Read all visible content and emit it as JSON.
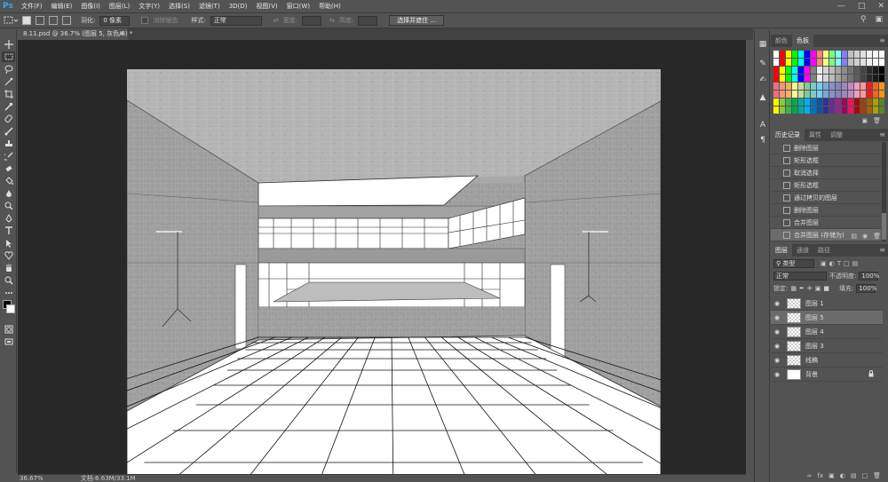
{
  "app": {
    "logo": "Ps"
  },
  "menu": [
    "文件(F)",
    "编辑(E)",
    "图像(I)",
    "图层(L)",
    "文字(Y)",
    "选择(S)",
    "滤镜(T)",
    "3D(D)",
    "视图(V)",
    "窗口(W)",
    "帮助(H)"
  ],
  "options": {
    "feather_label": "羽化:",
    "feather_value": "0 像素",
    "antialias_label": "消除锯齿",
    "style_label": "样式:",
    "style_value": "正常",
    "width_label": "宽度:",
    "height_label": "高度:",
    "select_mask_button": "选择并遮住 ..."
  },
  "document": {
    "tab_title": "8.11.psd @ 36.7% (图层 5, 灰色/8) *",
    "close": "×"
  },
  "status": {
    "zoom": "36.67%",
    "doc_size": "文档:6.63M/33.1M"
  },
  "color_panel": {
    "tabs": [
      "颜色",
      "色板"
    ],
    "active": 1
  },
  "swatch_colors": {
    "row1": [
      "#ffffff",
      "#ff0000",
      "#ffff00",
      "#00ff00",
      "#00ffff",
      "#0000ff",
      "#ff00ff",
      "#ff8080",
      "#ffff80",
      "#80ff80",
      "#80ffff",
      "#8080ff",
      "#c0c0c0",
      "#d0d0d0",
      "#e0e0e0",
      "#f0f0f0",
      "#f8f8f8",
      "#ffffff"
    ],
    "row2": [
      "#ff0000",
      "#ffff00",
      "#00ff00",
      "#00ffff",
      "#0000ff",
      "#ff00ff",
      "#808080",
      "#ececec",
      "#d4d4d4",
      "#bcbcbc",
      "#a4a4a4",
      "#8c8c8c",
      "#747474",
      "#5c5c5c",
      "#444444",
      "#2c2c2c",
      "#1a1a1a",
      "#000000"
    ],
    "row3": [
      "#f26d7d",
      "#f7977a",
      "#fbaf5d",
      "#fff799",
      "#c4df9b",
      "#82ca9c",
      "#7accc8",
      "#6ecff6",
      "#7ea7d8",
      "#8493ca",
      "#8882be",
      "#a187be",
      "#bc8dbf",
      "#f49ac2",
      "#f6989d",
      "#ed1c24",
      "#f26522",
      "#f7941d"
    ],
    "row4": [
      "#fff200",
      "#8dc63f",
      "#39b54a",
      "#00a651",
      "#00a99d",
      "#00aeef",
      "#0072bc",
      "#0054a6",
      "#2e3192",
      "#662d91",
      "#92278f",
      "#9e005d",
      "#ed145b",
      "#9e0b0f",
      "#a0410d",
      "#a36209",
      "#aba000",
      "#598527"
    ]
  },
  "history": {
    "tabs": [
      "历史记录",
      "属性",
      "调整"
    ],
    "items": [
      "删除图层",
      "矩形选框",
      "取消选择",
      "矩形选框",
      "通过拷贝的图层",
      "删除图层",
      "合并图层",
      "合并图层 (存储为)"
    ]
  },
  "layers": {
    "tabs": [
      "图层",
      "通道",
      "路径"
    ],
    "kind_label": "类型",
    "blend_mode": "正常",
    "opacity_label": "不透明度:",
    "opacity_value": "100%",
    "lock_label": "锁定:",
    "fill_label": "填充:",
    "fill_value": "100%",
    "items": [
      "图层 1",
      "图层 5",
      "图层 4",
      "图层 3",
      "线稿",
      "背景"
    ]
  }
}
